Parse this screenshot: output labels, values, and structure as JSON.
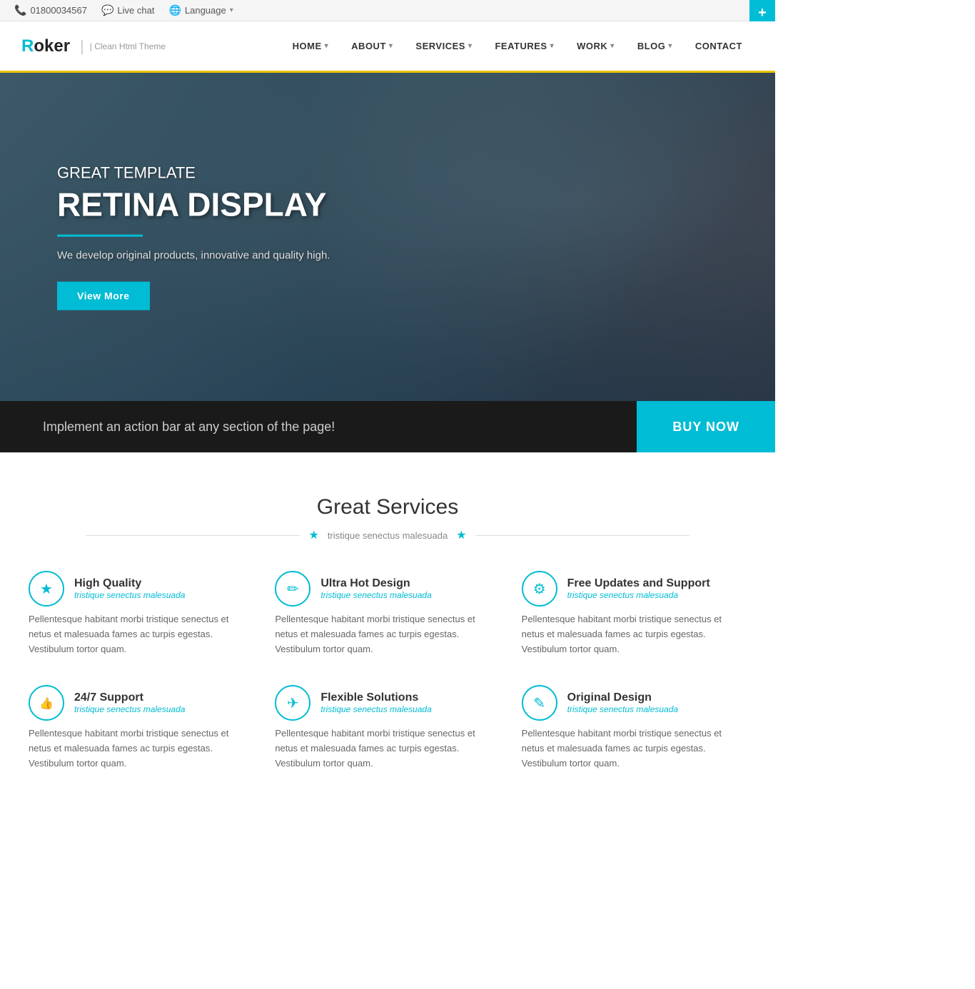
{
  "topbar": {
    "phone": "01800034567",
    "live_chat": "Live chat",
    "language": "Language",
    "plus_label": "+"
  },
  "navbar": {
    "logo_letter": "R",
    "logo_rest": "oker",
    "logo_sub": "| Clean Html Theme",
    "nav_items": [
      {
        "label": "HOME",
        "has_dropdown": true
      },
      {
        "label": "ABOUT",
        "has_dropdown": true
      },
      {
        "label": "SERVICES",
        "has_dropdown": true
      },
      {
        "label": "FEATURES",
        "has_dropdown": true
      },
      {
        "label": "WORK",
        "has_dropdown": true
      },
      {
        "label": "BLOG",
        "has_dropdown": true
      },
      {
        "label": "CONTACT",
        "has_dropdown": false
      }
    ]
  },
  "hero": {
    "subtitle": "GREAT TEMPLATE",
    "title": "RETINA DISPLAY",
    "description": "We develop original products, innovative and quality high.",
    "cta": "View More"
  },
  "action_bar": {
    "text": "Implement an action bar at any section of the page!",
    "button": "BUY NOW"
  },
  "services": {
    "section_title": "Great Services",
    "section_tagline": "tristique senectus malesuada",
    "cards": [
      {
        "icon": "star",
        "name": "High Quality",
        "tagline": "tristique senectus malesuada",
        "desc": "Pellentesque habitant morbi tristique senectus et netus et malesuada fames ac turpis egestas. Vestibulum tortor quam."
      },
      {
        "icon": "brush",
        "name": "Ultra Hot Design",
        "tagline": "tristique senectus malesuada",
        "desc": "Pellentesque habitant morbi tristique senectus et netus et malesuada fames ac turpis egestas. Vestibulum tortor quam."
      },
      {
        "icon": "share",
        "name": "Free Updates and Support",
        "tagline": "tristique senectus malesuada",
        "desc": "Pellentesque habitant morbi tristique senectus et netus et malesuada fames ac turpis egestas. Vestibulum tortor quam."
      },
      {
        "icon": "thumb",
        "name": "24/7 Support",
        "tagline": "tristique senectus malesuada",
        "desc": "Pellentesque habitant morbi tristique senectus et netus et malesuada fames ac turpis egestas. Vestibulum tortor quam."
      },
      {
        "icon": "plane",
        "name": "Flexible Solutions",
        "tagline": "tristique senectus malesuada",
        "desc": "Pellentesque habitant morbi tristique senectus et netus et malesuada fames ac turpis egestas. Vestibulum tortor quam."
      },
      {
        "icon": "pencil",
        "name": "Original Design",
        "tagline": "tristique senectus malesuada",
        "desc": "Pellentesque habitant morbi tristique senectus et netus et malesuada fames ac turpis egestas. Vestibulum tortor quam."
      }
    ]
  }
}
